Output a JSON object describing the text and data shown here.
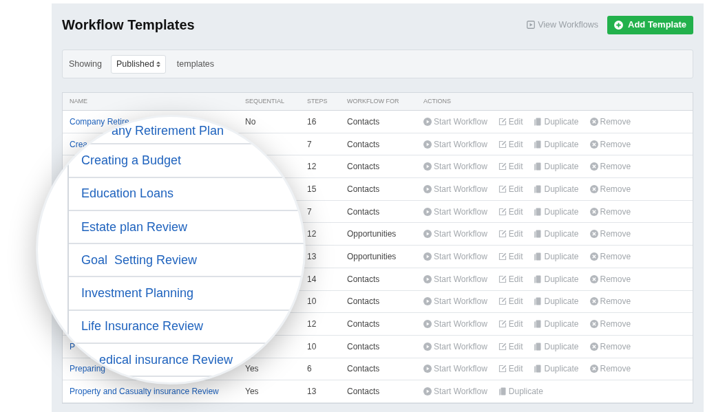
{
  "page": {
    "title": "Workflow Templates",
    "view_link": "View Workflows",
    "add_button": "Add Template"
  },
  "filter": {
    "prefix": "Showing",
    "select_value": "Published",
    "suffix": "templates"
  },
  "table": {
    "columns": [
      "NAME",
      "SEQUENTIAL",
      "STEPS",
      "WORKFLOW FOR",
      "ACTIONS"
    ],
    "rows": [
      {
        "name": "Company Retire",
        "sequential": "No",
        "steps": "16",
        "workflow_for": "Contacts",
        "actions": [
          {
            "kind": "start",
            "label": "Start Workflow"
          },
          {
            "kind": "edit",
            "label": "Edit"
          },
          {
            "kind": "duplicate",
            "label": "Duplicate"
          },
          {
            "kind": "remove",
            "label": "Remove"
          }
        ]
      },
      {
        "name": "Crea",
        "steps": "7",
        "workflow_for": "Contacts",
        "actions": [
          {
            "kind": "start",
            "label": "Start Workflow"
          },
          {
            "kind": "edit",
            "label": "Edit"
          },
          {
            "kind": "duplicate",
            "label": "Duplicate"
          },
          {
            "kind": "remove",
            "label": "Remove"
          }
        ]
      },
      {
        "steps": "12",
        "workflow_for": "Contacts",
        "actions": [
          {
            "kind": "start",
            "label": "Start Workflow"
          },
          {
            "kind": "edit",
            "label": "Edit"
          },
          {
            "kind": "duplicate",
            "label": "Duplicate"
          },
          {
            "kind": "remove",
            "label": "Remove"
          }
        ]
      },
      {
        "steps": "15",
        "workflow_for": "Contacts",
        "actions": [
          {
            "kind": "start",
            "label": "Start Workflow"
          },
          {
            "kind": "edit",
            "label": "Edit"
          },
          {
            "kind": "duplicate",
            "label": "Duplicate"
          },
          {
            "kind": "remove",
            "label": "Remove"
          }
        ]
      },
      {
        "steps": "7",
        "workflow_for": "Contacts",
        "actions": [
          {
            "kind": "start",
            "label": "Start Workflow"
          },
          {
            "kind": "edit",
            "label": "Edit"
          },
          {
            "kind": "duplicate",
            "label": "Duplicate"
          },
          {
            "kind": "remove",
            "label": "Remove"
          }
        ]
      },
      {
        "steps": "12",
        "workflow_for": "Opportunities",
        "actions": [
          {
            "kind": "start",
            "label": "Start Workflow"
          },
          {
            "kind": "edit",
            "label": "Edit"
          },
          {
            "kind": "duplicate",
            "label": "Duplicate"
          },
          {
            "kind": "remove",
            "label": "Remove"
          }
        ]
      },
      {
        "steps": "13",
        "workflow_for": "Opportunities",
        "actions": [
          {
            "kind": "start",
            "label": "Start Workflow"
          },
          {
            "kind": "edit",
            "label": "Edit"
          },
          {
            "kind": "duplicate",
            "label": "Duplicate"
          },
          {
            "kind": "remove",
            "label": "Remove"
          }
        ]
      },
      {
        "steps": "14",
        "workflow_for": "Contacts",
        "actions": [
          {
            "kind": "start",
            "label": "Start Workflow"
          },
          {
            "kind": "edit",
            "label": "Edit"
          },
          {
            "kind": "duplicate",
            "label": "Duplicate"
          },
          {
            "kind": "remove",
            "label": "Remove"
          }
        ]
      },
      {
        "steps": "10",
        "workflow_for": "Contacts",
        "actions": [
          {
            "kind": "start",
            "label": "Start Workflow"
          },
          {
            "kind": "edit",
            "label": "Edit"
          },
          {
            "kind": "duplicate",
            "label": "Duplicate"
          },
          {
            "kind": "remove",
            "label": "Remove"
          }
        ]
      },
      {
        "steps": "12",
        "workflow_for": "Contacts",
        "actions": [
          {
            "kind": "start",
            "label": "Start Workflow"
          },
          {
            "kind": "edit",
            "label": "Edit"
          },
          {
            "kind": "duplicate",
            "label": "Duplicate"
          },
          {
            "kind": "remove",
            "label": "Remove"
          }
        ]
      },
      {
        "name": "P",
        "steps": "10",
        "workflow_for": "Contacts",
        "actions": [
          {
            "kind": "start",
            "label": "Start Workflow"
          },
          {
            "kind": "edit",
            "label": "Edit"
          },
          {
            "kind": "duplicate",
            "label": "Duplicate"
          },
          {
            "kind": "remove",
            "label": "Remove"
          }
        ]
      },
      {
        "name": "Preparing",
        "sequential": "Yes",
        "steps": "6",
        "workflow_for": "Contacts",
        "actions": [
          {
            "kind": "start",
            "label": "Start Workflow"
          },
          {
            "kind": "edit",
            "label": "Edit"
          },
          {
            "kind": "duplicate",
            "label": "Duplicate"
          },
          {
            "kind": "remove",
            "label": "Remove"
          }
        ]
      },
      {
        "name": "Property and Casualty insurance Review",
        "sequential": "Yes",
        "steps": "13",
        "workflow_for": "Contacts",
        "actions": [
          {
            "kind": "start",
            "label": "Start Workflow"
          },
          {
            "kind": "duplicate",
            "label": "Duplicate"
          }
        ]
      }
    ]
  },
  "magnifier": {
    "items": [
      "any Retirement Plan",
      "Creating a Budget",
      "Education Loans",
      "Estate plan Review",
      "Goal  Setting Review",
      "Investment Planning",
      "Life Insurance Review",
      "edical insurance Review"
    ]
  }
}
